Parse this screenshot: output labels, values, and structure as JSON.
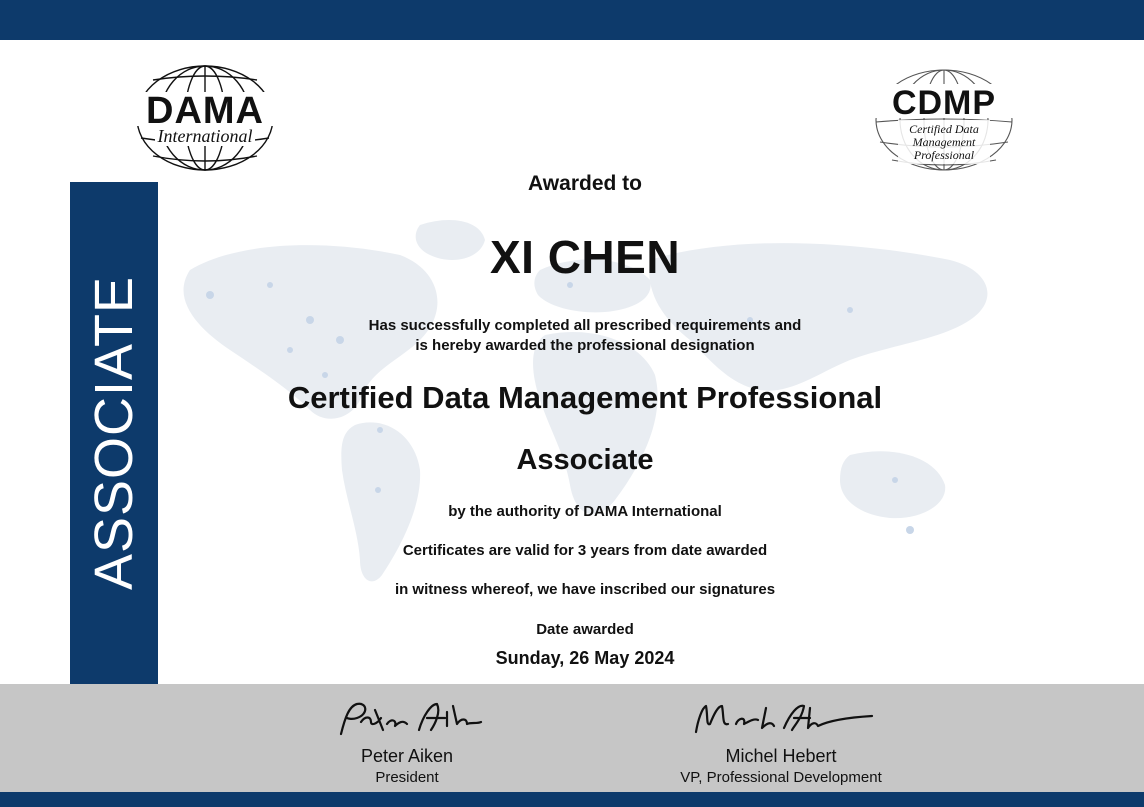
{
  "side_label": "ASSOCIATE",
  "logos": {
    "left": {
      "word": "DAMA",
      "subtitle": "International"
    },
    "right": {
      "word": "CDMP",
      "line1": "Certified Data",
      "line2": "Management",
      "line3": "Professional"
    }
  },
  "certificate": {
    "awarded_to_label": "Awarded to",
    "recipient_name": "XI CHEN",
    "requirement_line1": "Has successfully completed all prescribed requirements and",
    "requirement_line2": "is hereby awarded the professional designation",
    "designation": "Certified Data Management Professional",
    "level": "Associate",
    "authority": "by the authority of DAMA International",
    "validity": "Certificates are valid for 3 years from date awarded",
    "witness": "in witness whereof, we have inscribed our signatures",
    "date_label": "Date awarded",
    "date_value": "Sunday, 26 May 2024"
  },
  "signatories": [
    {
      "name": "Peter Aiken",
      "title": "President",
      "signature": "Peter Aiken"
    },
    {
      "name": "Michel Hebert",
      "title": "VP, Professional Development",
      "signature": "Michel Hebert"
    }
  ],
  "colors": {
    "brand_navy": "#0d3a6b",
    "footer_gray": "#c6c6c6",
    "map_tint": "#e6ebf1"
  }
}
